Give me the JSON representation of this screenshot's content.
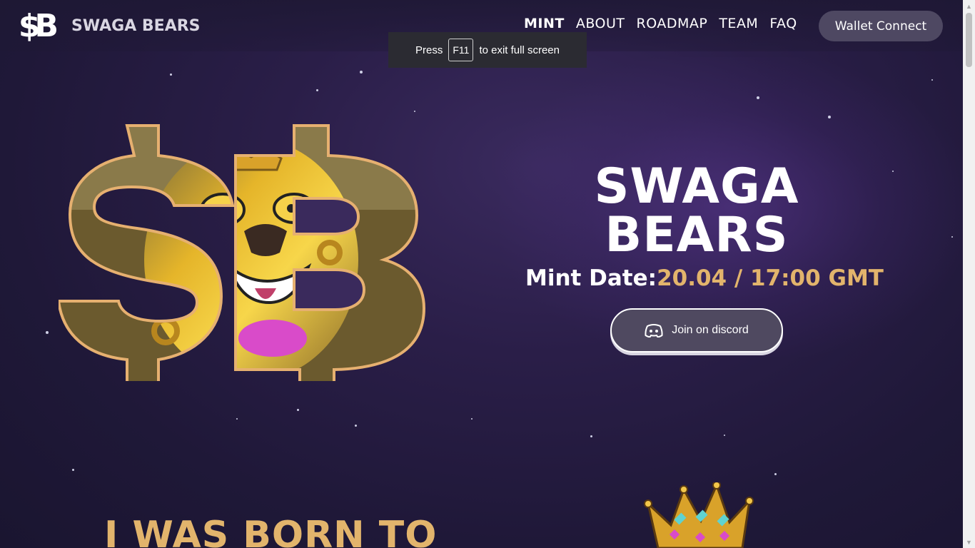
{
  "brand": {
    "logo_mark": "$B",
    "name": "SWAGA BEARS"
  },
  "nav": {
    "items": [
      {
        "label": "MINT",
        "active": true
      },
      {
        "label": "ABOUT"
      },
      {
        "label": "ROADMAP"
      },
      {
        "label": "TEAM"
      },
      {
        "label": "FAQ"
      }
    ]
  },
  "wallet_button": "Wallet Connect",
  "fullscreen_toast": {
    "prefix": "Press",
    "key": "F11",
    "suffix": "to exit full screen"
  },
  "hero": {
    "title_line1": "SWAGA",
    "title_line2": "BEARS",
    "mint_label": "Mint Date:",
    "mint_value": "20.04 / 17:00 GMT",
    "discord_button": "Join on discord"
  },
  "section": {
    "title": "I WAS BORN TO"
  },
  "icons": [
    "dollar-b-logo-icon",
    "discord-icon",
    "crown-icon"
  ],
  "colors": {
    "accent_gold": "#e2b46c",
    "button_bg": "#4e4862",
    "background": "#241c40"
  }
}
